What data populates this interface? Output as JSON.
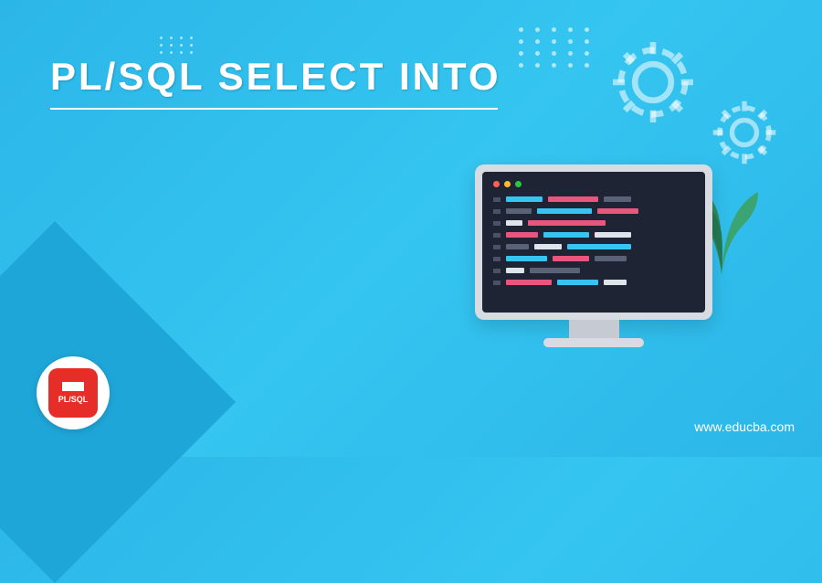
{
  "title": "PL/SQL SELECT INTO",
  "badge": {
    "label": "PL/SQL"
  },
  "website": "www.educba.com"
}
